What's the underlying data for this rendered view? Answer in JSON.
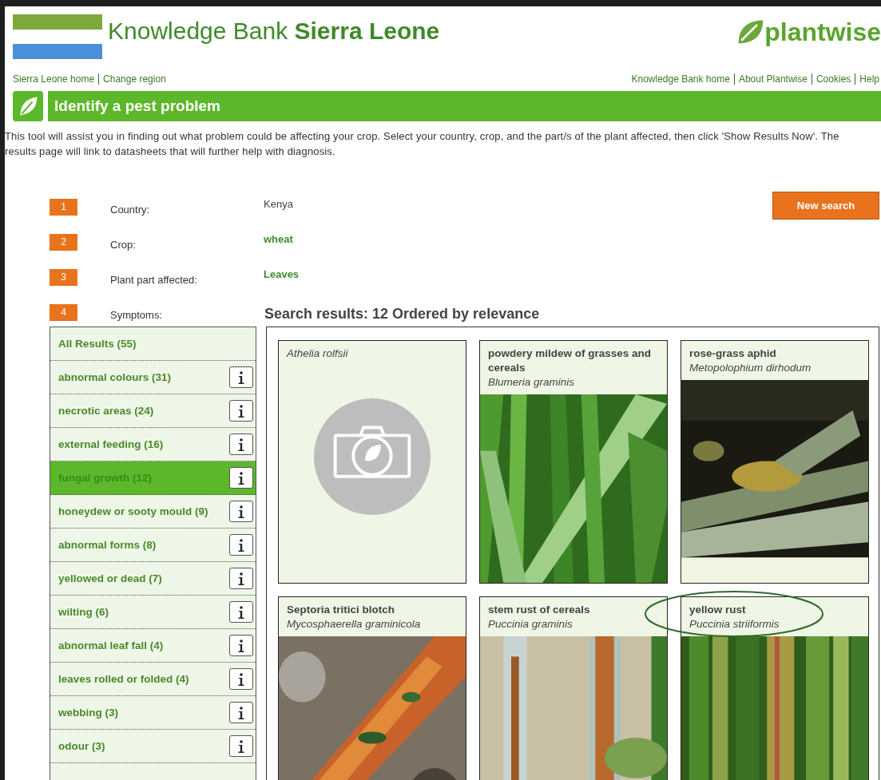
{
  "header": {
    "title": "Knowledge Bank **Sierra Leone**",
    "logo_text": "plantwise"
  },
  "nav": {
    "left": [
      "Sierra Leone home",
      "Change region"
    ],
    "right": [
      "Knowledge Bank home",
      "About Plantwise",
      "Cookies",
      "Help"
    ]
  },
  "banner": {
    "title": "Identify a pest problem"
  },
  "intro": "This tool will assist you in finding out what problem could be affecting your crop. Select your country, crop, and the part/s of the plant affected, then click 'Show Results Now'. The results page will link to datasheets that will further help with diagnosis.",
  "steps": [
    {
      "number": "1",
      "label": "Country:",
      "value": "Kenya",
      "kind": "plain"
    },
    {
      "number": "2",
      "label": "Crop:",
      "value": "wheat",
      "kind": "link"
    },
    {
      "number": "3",
      "label": "Plant part affected:",
      "value": "Leaves",
      "kind": "link"
    },
    {
      "number": "4",
      "label": "Symptoms:"
    }
  ],
  "new_search_button": "New search",
  "results_heading": "Search results: 12 Ordered by relevance",
  "symptoms": [
    {
      "label": "All Results (55)",
      "info": false,
      "selected": false
    },
    {
      "label": "abnormal colours (31)",
      "info": true,
      "selected": false
    },
    {
      "label": "necrotic areas (24)",
      "info": true,
      "selected": false
    },
    {
      "label": "external feeding (16)",
      "info": true,
      "selected": false
    },
    {
      "label": "fungal growth (12)",
      "info": true,
      "selected": true
    },
    {
      "label": "honeydew or sooty mould (9)",
      "info": true,
      "selected": false
    },
    {
      "label": "abnormal forms (8)",
      "info": true,
      "selected": false
    },
    {
      "label": "yellowed or dead (7)",
      "info": true,
      "selected": false
    },
    {
      "label": "wilting (6)",
      "info": true,
      "selected": false
    },
    {
      "label": "abnormal leaf fall (4)",
      "info": true,
      "selected": false
    },
    {
      "label": "leaves rolled or folded (4)",
      "info": true,
      "selected": false
    },
    {
      "label": "webbing (3)",
      "info": true,
      "selected": false
    },
    {
      "label": "odour (3)",
      "info": true,
      "selected": false
    }
  ],
  "results": [
    {
      "scientific_name": "Athelia rolfsii",
      "kind": "no-image",
      "circled": false
    },
    {
      "common_name": "powdery mildew of grasses and cereals",
      "scientific_name": "Blumeria graminis",
      "kind": "picture",
      "circled": false
    },
    {
      "common_name": "rose-grass aphid",
      "scientific_name": "Metopolophium dirhodum",
      "kind": "picture",
      "circled": false
    },
    {
      "common_name": "Septoria tritici blotch",
      "scientific_name": "Mycosphaerella graminicola",
      "kind": "picture",
      "circled": false
    },
    {
      "common_name": "stem rust of cereals",
      "scientific_name": "Puccinia graminis",
      "kind": "picture",
      "circled": false
    },
    {
      "common_name": "yellow rust",
      "scientific_name": "Puccinia striiformis",
      "kind": "picture",
      "circled": true
    }
  ]
}
